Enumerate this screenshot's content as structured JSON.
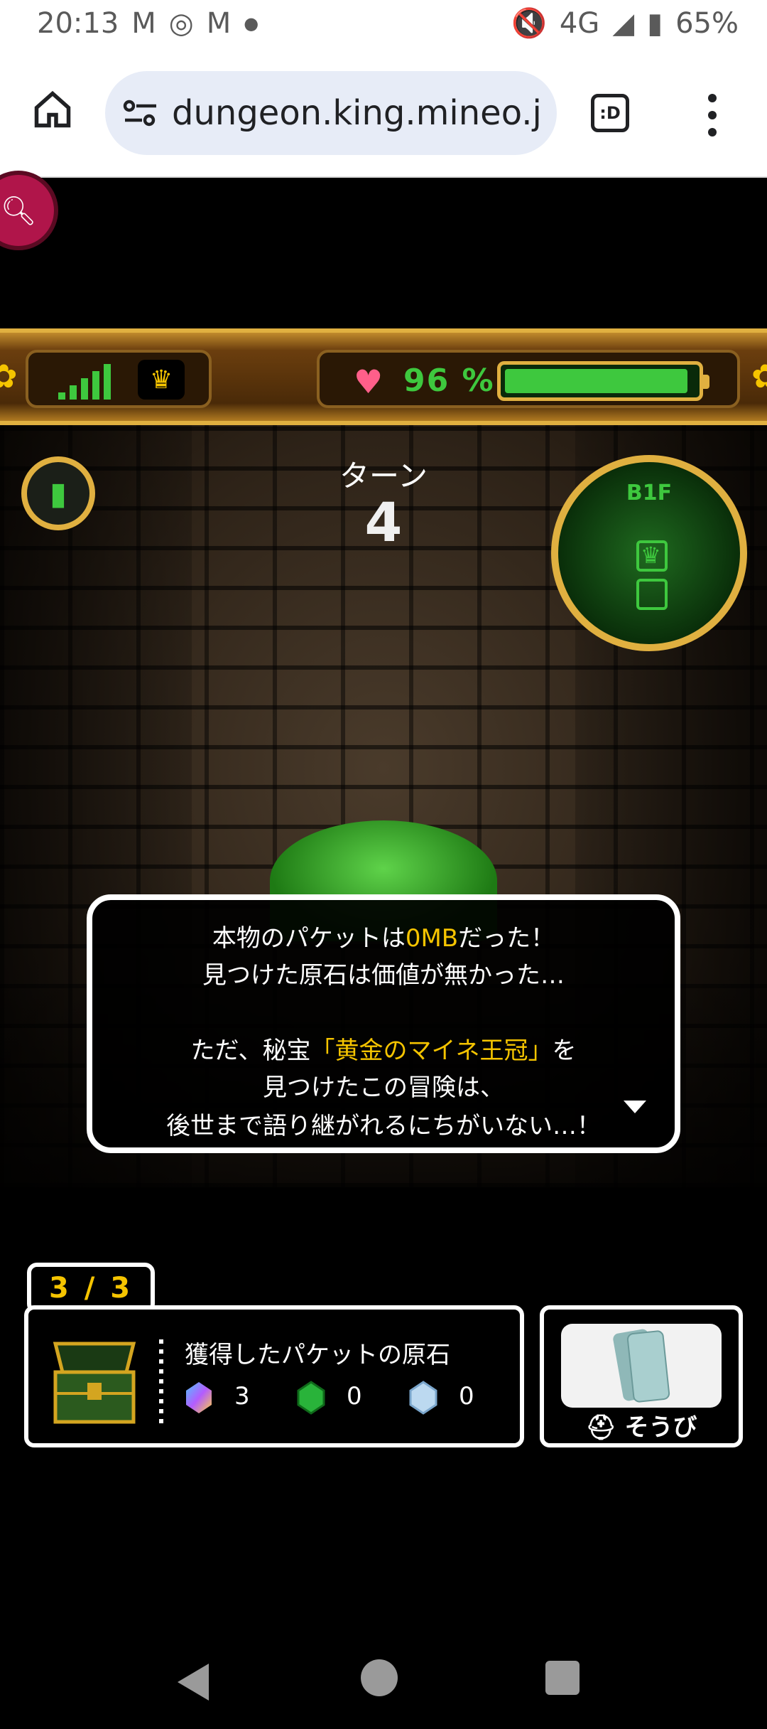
{
  "status_bar": {
    "time": "20:13",
    "network": "4G",
    "battery": "65%"
  },
  "browser": {
    "url": "dungeon.king.mineo.jp/",
    "tab_icon_text": ":D"
  },
  "game": {
    "battery_percent_label": "96 %",
    "battery_level": 0.96,
    "turn_label": "ターン",
    "turn_number": "4",
    "floor": "B1F",
    "dialog": {
      "line1_pre": "本物のパケットは",
      "line1_hl": "0MB",
      "line1_post": "だった！",
      "line2": "見つけた原石は価値が無かった…",
      "line3_pre": "ただ、秘宝",
      "line3_hl": "「黄金のマイネ王冠」",
      "line3_post": "を",
      "line4": "見つけたこの冒険は、",
      "line5": "後世まで語り継がれるにちがいない…！"
    }
  },
  "inventory": {
    "counter": "3 / 3",
    "title": "獲得したパケットの原石",
    "gems": [
      {
        "icon": "rainbow-gem-icon",
        "count": "3"
      },
      {
        "icon": "green-gem-icon",
        "count": "0"
      },
      {
        "icon": "blue-gem-icon",
        "count": "0"
      }
    ],
    "equip_label": "そうび"
  }
}
